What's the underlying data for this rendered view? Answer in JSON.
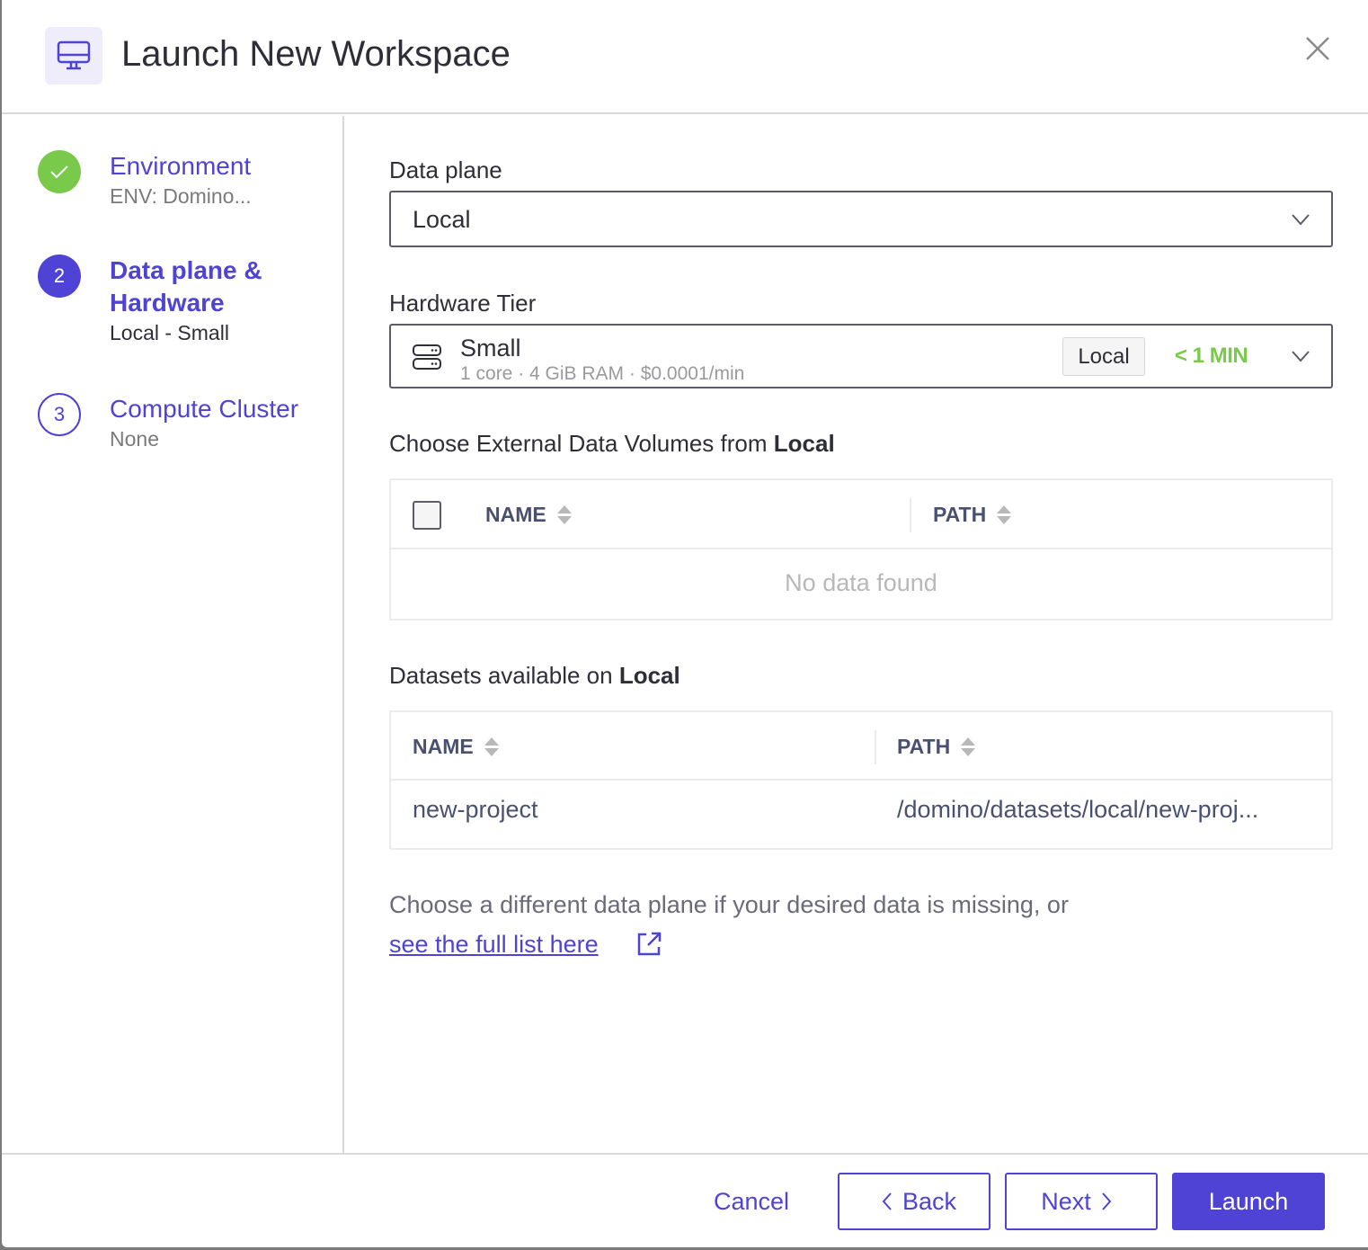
{
  "modal": {
    "title": "Launch New Workspace",
    "icon": "monitor-icon",
    "close_icon": "close-icon"
  },
  "steps": [
    {
      "number": "",
      "status": "complete",
      "title": "Environment",
      "subtitle": "ENV: Domino..."
    },
    {
      "number": "2",
      "status": "active",
      "title": "Data plane & Hardware",
      "title_line1": "Data plane &",
      "title_line2": "Hardware",
      "subtitle": "Local - Small"
    },
    {
      "number": "3",
      "status": "pending",
      "title": "Compute Cluster",
      "subtitle": "None"
    }
  ],
  "data_plane": {
    "label": "Data plane",
    "value": "Local"
  },
  "hardware_tier": {
    "label": "Hardware Tier",
    "name": "Small",
    "spec": "1 core · 4 GiB RAM · $0.0001/min",
    "tag": "Local",
    "time_estimate": "< 1 MIN"
  },
  "external_volumes": {
    "title_prefix": "Choose External Data Volumes from ",
    "title_bold": "Local",
    "columns": [
      "NAME",
      "PATH"
    ],
    "empty_text": "No data found",
    "rows": []
  },
  "datasets": {
    "title_prefix": "Datasets available on ",
    "title_bold": "Local",
    "columns": [
      "NAME",
      "PATH"
    ],
    "rows": [
      {
        "name": "new-project",
        "path": "/domino/datasets/local/new-proj..."
      }
    ]
  },
  "help": {
    "text": "Choose a different data plane if your desired data is missing, or",
    "link": "see the full list here"
  },
  "footer": {
    "cancel": "Cancel",
    "back": "Back",
    "next": "Next",
    "launch": "Launch"
  },
  "colors": {
    "accent": "#4f43d6",
    "success": "#79c94a",
    "border": "#d9d9d9"
  }
}
